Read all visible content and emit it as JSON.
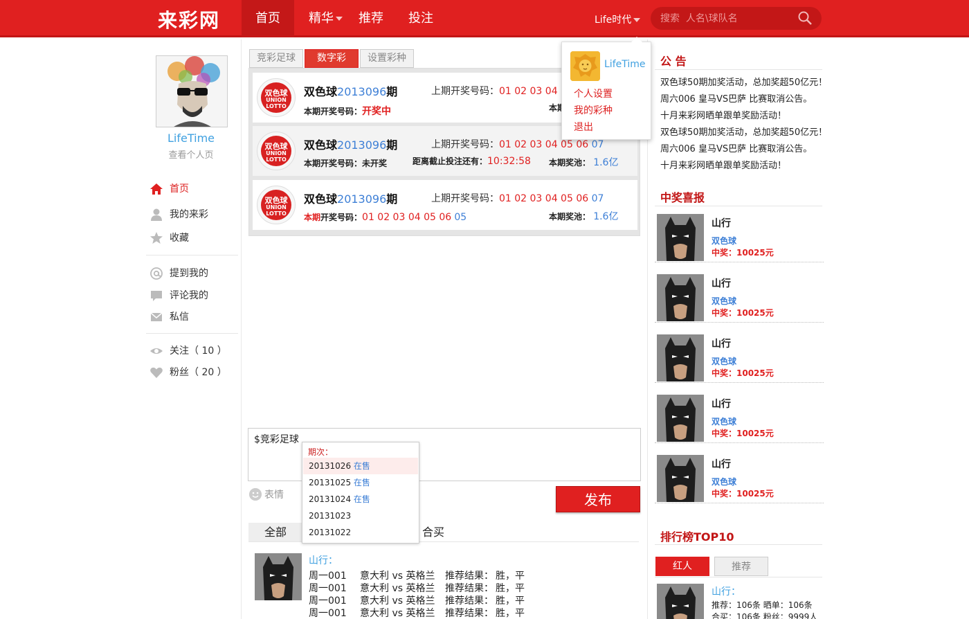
{
  "header": {
    "logo": "来彩网",
    "nav": [
      "首页",
      "精华",
      "推荐",
      "投注"
    ],
    "user_menu": "Life时代",
    "search_placeholder": "搜索  人名\\球队名"
  },
  "dropdown": {
    "name": "LifeTime",
    "items": [
      "个人设置",
      "我的彩种",
      "退出"
    ]
  },
  "profile": {
    "name": "LifeTime",
    "link": "查看个人页"
  },
  "sidebar": {
    "items": [
      {
        "label": "首页",
        "icon": "home-icon"
      },
      {
        "label": "我的来彩",
        "icon": "user-icon"
      },
      {
        "label": "收藏",
        "icon": "star-icon"
      },
      {
        "label": "提到我的",
        "icon": "at-icon"
      },
      {
        "label": "评论我的",
        "icon": "comment-icon"
      },
      {
        "label": "私信",
        "icon": "mail-icon"
      },
      {
        "label": "关注（ 10 ）",
        "icon": "eye-icon"
      },
      {
        "label": "粉丝（ 20 ）",
        "icon": "heart-icon"
      }
    ]
  },
  "tabs": [
    "竞彩足球",
    "数字彩",
    "设置彩种"
  ],
  "lottery": {
    "ball_text": [
      "双色球",
      "UNION",
      "LOTTO"
    ],
    "rows": [
      {
        "name": "双色球",
        "issue": "2013096",
        "suffix": "期",
        "prev_label": "上期开奖号码：",
        "prev_nums": "01  02  03  04",
        "cur_label": "本期开奖号码：",
        "cur_value": "开奖中",
        "pool_label": "本期"
      },
      {
        "name": "双色球",
        "issue": "2013096",
        "suffix": "期",
        "prev_label": "上期开奖号码：",
        "prev_red": "01  02  03  04  05  06",
        "prev_blue": "07",
        "cur_label": "本期开奖号码：",
        "cur_value": "未开奖",
        "dead_label": "距离截止投注还有：",
        "dead_value": "10:32:58",
        "pool_label": "本期奖池：",
        "pool_value": "1.6亿"
      },
      {
        "name": "双色球",
        "issue": "2013096",
        "suffix": "期",
        "prev_label": "上期开奖号码：",
        "prev_red": "01  02  03  04  05  06",
        "prev_blue": "07",
        "cur_label_red": "本期",
        "cur_label": "开奖号码：",
        "cur_red": "01 02 03 04 05 06",
        "cur_blue": "05",
        "pool_label": "本期奖池：",
        "pool_value": "1.6亿"
      }
    ]
  },
  "composer": {
    "text": "$竞彩足球",
    "emoji_label": "表情",
    "publish": "发布",
    "issue_label": "期次：",
    "issues": [
      {
        "id": "20131026",
        "status": "在售"
      },
      {
        "id": "20131025",
        "status": "在售"
      },
      {
        "id": "20131024",
        "status": "在售"
      },
      {
        "id": "20131023",
        "status": ""
      },
      {
        "id": "20131022",
        "status": ""
      }
    ]
  },
  "feed_tabs": [
    "全部",
    "合买"
  ],
  "feed": {
    "name": "山行：",
    "lines": [
      {
        "week": "周一001",
        "match": "意大利 vs 英格兰",
        "label": "推荐结果：",
        "result": "胜，平"
      },
      {
        "week": "周一001",
        "match": "意大利 vs 英格兰",
        "label": "推荐结果：",
        "result": "胜，平"
      },
      {
        "week": "周一001",
        "match": "意大利 vs 英格兰",
        "label": "推荐结果：",
        "result": "胜，平"
      },
      {
        "week": "周一001",
        "match": "意大利 vs 英格兰",
        "label": "推荐结果：",
        "result": "胜，平"
      }
    ]
  },
  "notice": {
    "title": "公 告",
    "items": [
      "双色球50期加奖活动，总加奖超50亿元！",
      "周六006 皇马VS巴萨 比赛取消公告。",
      "十月来彩网晒单跟单奖励活动！",
      "双色球50期加奖活动，总加奖超50亿元！",
      "周六006 皇马VS巴萨 比赛取消公告。",
      "十月来彩网晒单跟单奖励活动！"
    ]
  },
  "winners": {
    "title": "中奖喜报",
    "items": [
      {
        "name": "山行",
        "lottery": "双色球",
        "prize": "中奖：10025元"
      },
      {
        "name": "山行",
        "lottery": "双色球",
        "prize": "中奖：10025元"
      },
      {
        "name": "山行",
        "lottery": "双色球",
        "prize": "中奖：10025元"
      },
      {
        "name": "山行",
        "lottery": "双色球",
        "prize": "中奖：10025元"
      },
      {
        "name": "山行",
        "lottery": "双色球",
        "prize": "中奖：10025元"
      }
    ]
  },
  "ranking": {
    "title": "排行榜TOP10",
    "tabs": [
      "红人",
      "推荐"
    ],
    "name": "山行：",
    "stat1": "推荐：106条    晒单：106条",
    "stat2": "合买：106条    粉丝：9999人"
  },
  "colors": {
    "brand": "#e02020",
    "link": "#3fa0e0",
    "issue": "#3d7fd6"
  }
}
